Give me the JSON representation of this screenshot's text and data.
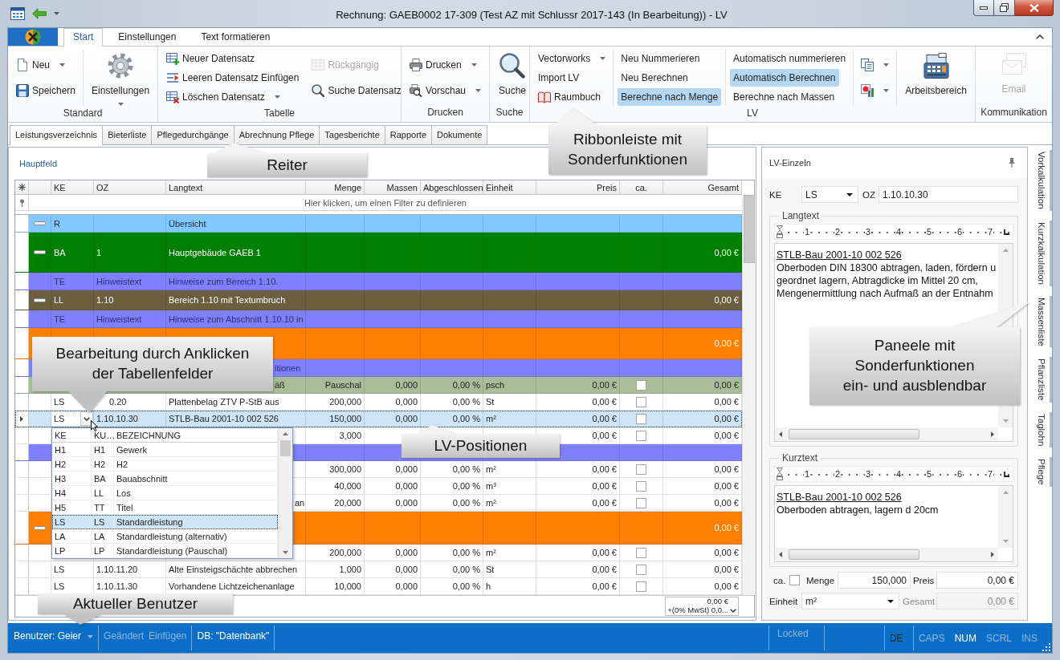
{
  "window": {
    "title": "Rechnung: GAEB0002 17-309 (Test AZ mit Schlussr 2017-143 (In Bearbeitung)) - LV"
  },
  "ribbon": {
    "tabs": [
      {
        "label": "Start",
        "selected": true
      },
      {
        "label": "Einstellungen",
        "selected": false
      },
      {
        "label": "Text formatieren",
        "selected": false
      }
    ],
    "groups": [
      {
        "label": "Standard",
        "columns": [
          {
            "kind": "stack",
            "items": [
              {
                "label": "Neu",
                "dropdown": true,
                "disabled": false
              },
              {
                "label": "Speichern",
                "dropdown": false,
                "disabled": false
              }
            ]
          },
          {
            "kind": "large",
            "items": [
              {
                "label": "Einstellungen",
                "dropdown": true,
                "disabled": false
              }
            ]
          }
        ]
      },
      {
        "label": "Tabelle",
        "columns": [
          {
            "kind": "stack",
            "items": [
              {
                "label": "Neuer Datensatz",
                "dropdown": false,
                "disabled": false
              },
              {
                "label": "Leeren Datensatz Einfügen",
                "dropdown": false,
                "disabled": false
              },
              {
                "label": "Löschen Datensatz",
                "dropdown": true,
                "disabled": false
              }
            ]
          },
          {
            "kind": "stack",
            "items": [
              {
                "label": "Rückgängig",
                "dropdown": false,
                "disabled": true
              },
              {
                "label": "Suche Datensatz",
                "dropdown": false,
                "disabled": false
              }
            ]
          }
        ]
      },
      {
        "label": "Drucken",
        "columns": [
          {
            "kind": "stack",
            "items": [
              {
                "label": "Drucken",
                "dropdown": true,
                "disabled": false
              },
              {
                "label": "Vorschau",
                "dropdown": true,
                "disabled": false
              }
            ]
          }
        ]
      },
      {
        "label": "Suche",
        "columns": [
          {
            "kind": "large",
            "items": [
              {
                "label": "Suche",
                "dropdown": false,
                "disabled": false
              }
            ]
          }
        ]
      },
      {
        "label": "LV",
        "columns": [
          {
            "kind": "stack",
            "items": [
              {
                "label": "Vectorworks",
                "dropdown": true,
                "disabled": false
              },
              {
                "label": "Import LV",
                "dropdown": false,
                "disabled": false
              },
              {
                "label": "Raumbuch",
                "dropdown": false,
                "disabled": false
              }
            ]
          },
          {
            "kind": "stack",
            "items": [
              {
                "label": "Neu Nummerieren",
                "dropdown": false,
                "disabled": false,
                "on": false
              },
              {
                "label": "Neu Berechnen",
                "dropdown": false,
                "disabled": false,
                "on": false
              },
              {
                "label": "Berechne nach Menge",
                "dropdown": false,
                "disabled": false,
                "on": true
              }
            ]
          },
          {
            "kind": "stack",
            "items": [
              {
                "label": "Automatisch nummerieren",
                "dropdown": false,
                "disabled": false,
                "on": false
              },
              {
                "label": "Automatisch Berechnen",
                "dropdown": false,
                "disabled": false,
                "on": true
              },
              {
                "label": "Berechne nach Massen",
                "dropdown": false,
                "disabled": false,
                "on": false
              }
            ]
          },
          {
            "kind": "icons",
            "items": [
              {
                "dropdown": true,
                "disabled": false
              },
              {
                "dropdown": true,
                "disabled": false
              }
            ]
          },
          {
            "kind": "large",
            "items": [
              {
                "label": "Arbeitsbereich",
                "dropdown": false,
                "disabled": false
              }
            ]
          }
        ]
      },
      {
        "label": "Kommunikation",
        "columns": [
          {
            "kind": "large",
            "items": [
              {
                "label": "Email",
                "dropdown": false,
                "disabled": true
              }
            ]
          }
        ]
      }
    ]
  },
  "document_tabs": [
    {
      "label": "Leistungsverzeichnis",
      "selected": true
    },
    {
      "label": "Bieterliste",
      "selected": false
    },
    {
      "label": "Pflegedurchgänge",
      "selected": false
    },
    {
      "label": "Abrechnung Pflege",
      "selected": false
    },
    {
      "label": "Tagesberichte",
      "selected": false
    },
    {
      "label": "Rapporte",
      "selected": false
    },
    {
      "label": "Dokumente",
      "selected": false
    }
  ],
  "main_panel": {
    "title": "Hauptfeld",
    "grid": {
      "columns": [
        "KE",
        "OZ",
        "Langtext",
        "Menge",
        "Massen",
        "Abgeschlossen",
        "Einheit",
        "Preis",
        "ca.",
        "Gesamt"
      ],
      "filter_hint": "Hier klicken, um einen Filter zu definieren",
      "rows": [
        {
          "kind": "overview",
          "color": "#80c8ff",
          "selected": false,
          "expanded": true,
          "cells": {
            "ke": "R",
            "langtext": "Übersicht"
          }
        },
        {
          "kind": "group",
          "color": "#008000",
          "selected": false,
          "expanded": true,
          "cells": {
            "ke": "BA",
            "oz": "1",
            "langtext": "Hauptgebäude GAEB 1",
            "gesamt": "0,00 €"
          }
        },
        {
          "kind": "note",
          "color": "#8080ff",
          "selected": false,
          "cells": {
            "ke": "TE",
            "oz": "Hinweistext",
            "langtext": "Hinweise zum Bereich 1.10."
          }
        },
        {
          "kind": "group",
          "color": "#6b5f3f",
          "selected": false,
          "expanded": true,
          "cells": {
            "ke": "LL",
            "oz": "1.10",
            "langtext": "Bereich 1.10 mit Textumbruch",
            "gesamt": "0,00 €"
          }
        },
        {
          "kind": "note",
          "color": "#8080ff",
          "selected": false,
          "cells": {
            "ke": "TE",
            "oz": "Hinweistext",
            "langtext": "Hinweise zum Abschnitt 1.10.10 in"
          }
        },
        {
          "kind": "group",
          "color": "#ff8000",
          "selected": false,
          "cells": {
            "gesamt": "0,00 €"
          }
        },
        {
          "kind": "note",
          "color": "#8080ff",
          "selected": false,
          "cells": {
            "langtext": "itionen"
          }
        },
        {
          "kind": "position",
          "color": "#a9bd98",
          "selected": false,
          "checked": false,
          "cells": {
            "langtext": "äß",
            "menge": "Pauschal",
            "massen": "0,000",
            "abgeschlossen": "0,00 %",
            "einheit": "psch",
            "preis": "0,00 €",
            "gesamt": "0,00 €"
          }
        },
        {
          "kind": "position",
          "selected": false,
          "checked": false,
          "cells": {
            "ke": "LS",
            "oz": "0.20",
            "langtext": "Plattenbelag ZTV P-StB aus",
            "menge": "200,000",
            "massen": "0,000",
            "abgeschlossen": "0,00 %",
            "einheit": "St",
            "preis": "0,00 €",
            "gesamt": "0,00 €"
          }
        },
        {
          "kind": "position",
          "selected": true,
          "checked": false,
          "cells": {
            "ke": "LS",
            "oz": "1.10.10.30",
            "langtext": "STLB-Bau 2001-10 002 526",
            "menge": "150,000",
            "massen": "0,000",
            "abgeschlossen": "0,00 %",
            "einheit": "m²",
            "preis": "0,00 €",
            "gesamt": "0,00 €"
          }
        },
        {
          "kind": "position",
          "selected": false,
          "checked": false,
          "cells": {
            "menge": "3,000",
            "preis": "0,00 €",
            "gesamt": "0,00 €"
          }
        },
        {
          "kind": "note",
          "color": "#8080ff",
          "selected": false
        },
        {
          "kind": "position",
          "selected": false,
          "checked": false,
          "cells": {
            "menge": "300,000",
            "massen": "0,000",
            "abgeschlossen": "0,00 %",
            "einheit": "m²",
            "preis": "0,00 €",
            "gesamt": "0,00 €"
          }
        },
        {
          "kind": "position",
          "selected": false,
          "checked": false,
          "cells": {
            "menge": "40,000",
            "massen": "0,000",
            "abgeschlossen": "0,00 %",
            "einheit": "m³",
            "preis": "0,00 €",
            "gesamt": "0,00 €"
          }
        },
        {
          "kind": "position",
          "selected": false,
          "checked": false,
          "cells": {
            "langtext": "an",
            "menge": "20,000",
            "massen": "0,000",
            "abgeschlossen": "0,00 %",
            "einheit": "m²",
            "preis": "0,00 €",
            "gesamt": "0,00 €"
          }
        },
        {
          "kind": "group",
          "color": "#ff8000",
          "selected": false,
          "expanded": true,
          "cells": {
            "gesamt": "0,00 €"
          }
        },
        {
          "kind": "position",
          "selected": false,
          "checked": false,
          "cells": {
            "menge": "200,000",
            "massen": "0,000",
            "abgeschlossen": "0,00 %",
            "einheit": "m²",
            "preis": "0,00 €",
            "gesamt": "0,00 €"
          }
        },
        {
          "kind": "position",
          "selected": false,
          "checked": false,
          "cells": {
            "ke": "LS",
            "oz": "1.10.11.20",
            "langtext": "Alte Einsteigschächte abbrechen",
            "menge": "1,000",
            "massen": "0,000",
            "abgeschlossen": "0,00 %",
            "einheit": "St",
            "preis": "0,00 €",
            "gesamt": "0,00 €"
          }
        },
        {
          "kind": "position",
          "selected": false,
          "checked": false,
          "cells": {
            "ke": "LS",
            "oz": "1.10.11.30",
            "langtext": "Vorhandene Lichtzeichenanlage",
            "menge": "10,000",
            "massen": "0,000",
            "abgeschlossen": "0,00 %",
            "einheit": "h",
            "preis": "0,00 €",
            "gesamt": "0,00 €"
          }
        }
      ],
      "ke_dropdown": {
        "columns": [
          "KE",
          "KU…",
          "BEZEICHNUNG"
        ],
        "items": [
          {
            "ke": "H1",
            "ku": "H1",
            "bezeichnung": "Gewerk",
            "selected": false
          },
          {
            "ke": "H2",
            "ku": "H2",
            "bezeichnung": "H2",
            "selected": false
          },
          {
            "ke": "H3",
            "ku": "BA",
            "bezeichnung": "Bauabschnitt",
            "selected": false
          },
          {
            "ke": "H4",
            "ku": "LL",
            "bezeichnung": "Los",
            "selected": false
          },
          {
            "ke": "H5",
            "ku": "TT",
            "bezeichnung": "Titel",
            "selected": false
          },
          {
            "ke": "LS",
            "ku": "LS",
            "bezeichnung": "Standardleistung",
            "selected": true
          },
          {
            "ke": "LA",
            "ku": "LA",
            "bezeichnung": "Standardleistung (alternativ)",
            "selected": false
          },
          {
            "ke": "LP",
            "ku": "LP",
            "bezeichnung": "Standardleistung (Pauschal)",
            "selected": false
          }
        ]
      },
      "total": {
        "amount": "0,00 €",
        "note": "+(0% MwSt) 0,0..."
      }
    }
  },
  "detail_panel": {
    "title": "LV-Einzeln",
    "ke": {
      "label": "KE",
      "value": "LS"
    },
    "oz": {
      "label": "OZ",
      "value": "1.10.10.30"
    },
    "langtext": {
      "label": "Langtext",
      "ruler": [
        "1",
        "2",
        "3",
        "4",
        "5",
        "6",
        "7"
      ],
      "heading": "STLB-Bau 2001-10 002 526",
      "body": "Oberboden DIN 18300 abtragen, laden, fördern u\ngeordnet lagern, Abtragdicke im Mittel 20 cm,\nMengenermittlung nach Aufmaß an der Entnahm"
    },
    "kurztext": {
      "label": "Kurztext",
      "ruler": [
        "1",
        "2",
        "3",
        "4",
        "5",
        "6",
        "7"
      ],
      "heading": "STLB-Bau 2001-10 002 526",
      "body": "Oberboden abtragen, lagern d 20cm"
    },
    "ca": {
      "label": "ca.",
      "checked": false
    },
    "menge": {
      "label": "Menge",
      "value": "150,000"
    },
    "preis": {
      "label": "Preis",
      "value": "0,00 €"
    },
    "einheit": {
      "label": "Einheit",
      "value": "m²"
    },
    "gesamt": {
      "label": "Gesamt",
      "value": "0,00 €",
      "disabled": true
    }
  },
  "side_tabs": [
    {
      "label": "Vorkalkulation"
    },
    {
      "label": "Kurzkalkulation"
    },
    {
      "label": "Massenliste"
    },
    {
      "label": "Pflanzliste"
    },
    {
      "label": "Taglohn"
    },
    {
      "label": "Pflege"
    }
  ],
  "status_bar": {
    "segments": [
      {
        "items": [
          {
            "label": "Benutzer: Geier",
            "disabled": false,
            "dropdown": true
          }
        ]
      },
      {
        "items": [
          {
            "label": "Geändert",
            "disabled": true,
            "dropdown": false
          },
          {
            "label": "Einfügen",
            "disabled": true,
            "dropdown": false
          }
        ]
      },
      {
        "items": [
          {
            "label": "DB: \"Datenbank\"",
            "disabled": false,
            "dropdown": false
          }
        ]
      }
    ],
    "locked": {
      "label": "Locked",
      "disabled": true
    },
    "language": "DE",
    "keys": [
      {
        "label": "CAPS",
        "on": false
      },
      {
        "label": "NUM",
        "on": true
      },
      {
        "label": "SCRL",
        "on": false
      },
      {
        "label": "INS",
        "on": false
      }
    ]
  },
  "callouts": [
    {
      "text": "Reiter"
    },
    {
      "text": "Ribbonleiste mit\nSonderfunktionen"
    },
    {
      "text": "Bearbeitung durch Anklicken\nder Tabellenfelder"
    },
    {
      "text": "LV-Positionen"
    },
    {
      "text": "Paneele mit\nSonderfunktionen\nein- und ausblendbar"
    },
    {
      "text": "Aktueller Benutzer"
    }
  ]
}
